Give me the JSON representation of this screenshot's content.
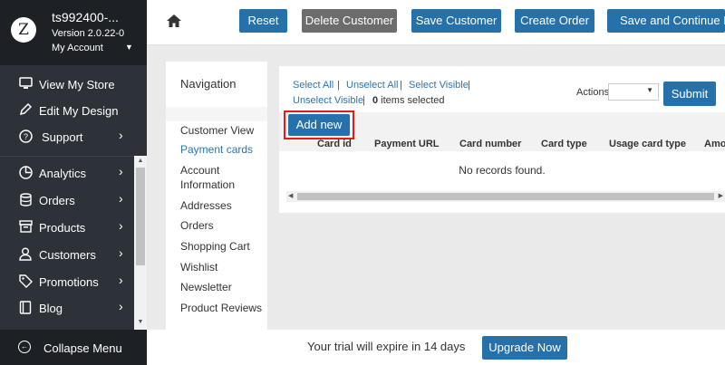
{
  "sidebar": {
    "store_name": "ts992400-...",
    "version": "Version 2.0.22-0",
    "account": "My Account",
    "logo_letter": "Z",
    "top_items": [
      {
        "label": "View My Store",
        "icon": "monitor-icon"
      },
      {
        "label": "Edit My Design",
        "icon": "pencil-icon"
      },
      {
        "label": "Support",
        "icon": "question-icon"
      }
    ],
    "items": [
      {
        "label": "Analytics",
        "icon": "chart-icon"
      },
      {
        "label": "Orders",
        "icon": "database-icon"
      },
      {
        "label": "Products",
        "icon": "box-icon"
      },
      {
        "label": "Customers",
        "icon": "user-icon"
      },
      {
        "label": "Promotions",
        "icon": "tag-icon"
      },
      {
        "label": "Blog",
        "icon": "book-icon"
      }
    ],
    "collapse_label": "Collapse Menu"
  },
  "topbar": {
    "reset": "Reset",
    "delete": "Delete Customer",
    "save": "Save Customer",
    "create_order": "Create Order",
    "save_continue": "Save and Continue Edit"
  },
  "navigation": {
    "title": "Navigation",
    "items": [
      {
        "label": "Customer View",
        "active": false
      },
      {
        "label": "Payment cards",
        "active": true
      },
      {
        "label": "Account Information",
        "active": false
      },
      {
        "label": "Addresses",
        "active": false
      },
      {
        "label": "Orders",
        "active": false
      },
      {
        "label": "Shopping Cart",
        "active": false
      },
      {
        "label": "Wishlist",
        "active": false
      },
      {
        "label": "Newsletter",
        "active": false
      },
      {
        "label": "Product Reviews",
        "active": false
      }
    ]
  },
  "grid": {
    "select_all": "Select All",
    "unselect_all": "Unselect All",
    "select_visible": "Select Visible",
    "unselect_visible": "Unselect Visible",
    "selected_count": "0",
    "selected_suffix": " items selected",
    "actions_label": "Actions",
    "actions_value": "",
    "submit": "Submit",
    "add_new": "Add new",
    "columns": [
      "Card id",
      "Payment URL",
      "Card number",
      "Card type",
      "Usage card type",
      "Amo"
    ],
    "empty_text": "No records found."
  },
  "trial": {
    "text": "Your trial will expire in 14 days",
    "upgrade": "Upgrade Now"
  },
  "colors": {
    "accent": "#2671a9",
    "sidebar_bg": "#2d3239",
    "highlight": "#e21b1b"
  }
}
